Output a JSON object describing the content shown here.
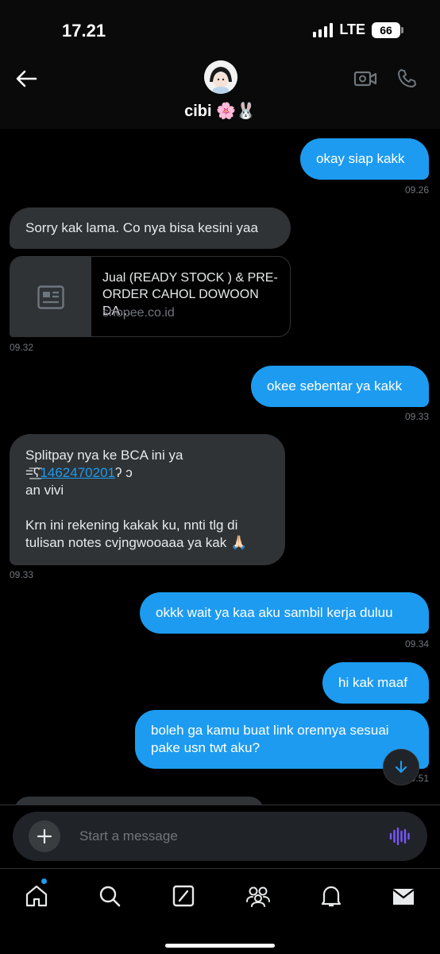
{
  "status_bar": {
    "time": "17.21",
    "network": "LTE",
    "battery": "66"
  },
  "header": {
    "contact_name": "cibi 🌸🐰"
  },
  "messages": [
    {
      "text": "okay siap kakk",
      "time": "09.26"
    },
    {
      "text": "Sorry kak lama. Co nya bisa kesini yaa"
    },
    {
      "link_title": "Jual (READY STOCK ) & PRE-ORDER CAHOL DOWOON DA...",
      "link_domain": "shopee.co.id",
      "time": "09.32"
    },
    {
      "text": "okee sebentar ya kakk",
      "time": "09.33"
    },
    {
      "line1": "Splitpay nya ke BCA ini ya",
      "account_prefix": "=͟͟͞͞ʕ",
      "account_number": "1462470201",
      "account_suffix": "ʔ ↄ",
      "line3": "an vivi",
      "line4": "Krn ini rekening kakak ku, nnti tlg di",
      "line5": "tulisan notes cvjngwooaaa ya kak 🙏🏻",
      "time": "09.33"
    },
    {
      "text": "okkk wait ya kaa aku sambil kerja duluu",
      "time": "09.34"
    },
    {
      "text": "hi kak maaf"
    },
    {
      "line1": "boleh ga kamu buat link orennya sesuai",
      "line2": "pake usn twt aku?",
      "time": "09.51"
    }
  ],
  "composer": {
    "placeholder": "Start a message"
  },
  "colors": {
    "accent": "#1d9bf0",
    "received_bubble": "#2f3336",
    "background": "#000000"
  },
  "icons": {
    "header": [
      "back-arrow-icon",
      "video-call-icon",
      "phone-icon"
    ],
    "tabs": [
      "home-icon",
      "search-icon",
      "grok-icon",
      "communities-icon",
      "notifications-icon",
      "messages-icon"
    ]
  }
}
